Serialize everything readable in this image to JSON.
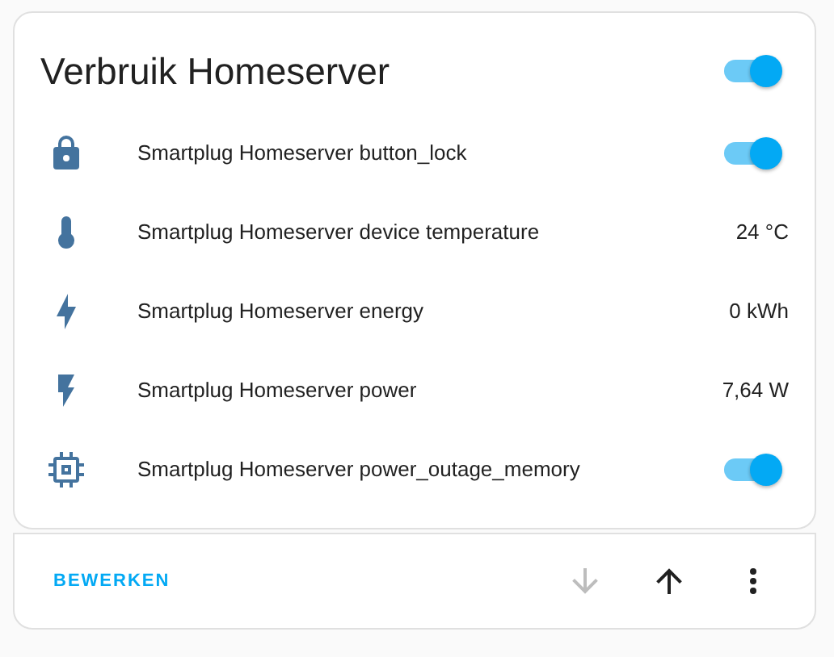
{
  "card": {
    "title": "Verbruik Homeserver",
    "header_toggle": {
      "on": true
    },
    "rows": [
      {
        "kind": "toggle",
        "name": "Smartplug Homeserver button_lock",
        "on": true
      },
      {
        "kind": "value",
        "name": "Smartplug Homeserver device temperature",
        "value": "24 °C"
      },
      {
        "kind": "value",
        "name": "Smartplug Homeserver energy",
        "value": "0 kWh"
      },
      {
        "kind": "value",
        "name": "Smartplug Homeserver power",
        "value": "7,64 W"
      },
      {
        "kind": "toggle",
        "name": "Smartplug Homeserver power_outage_memory",
        "on": true
      }
    ]
  },
  "footer": {
    "edit_label": "BEWERKEN",
    "move_down": {
      "disabled": true
    },
    "move_up": {
      "disabled": false
    }
  }
}
